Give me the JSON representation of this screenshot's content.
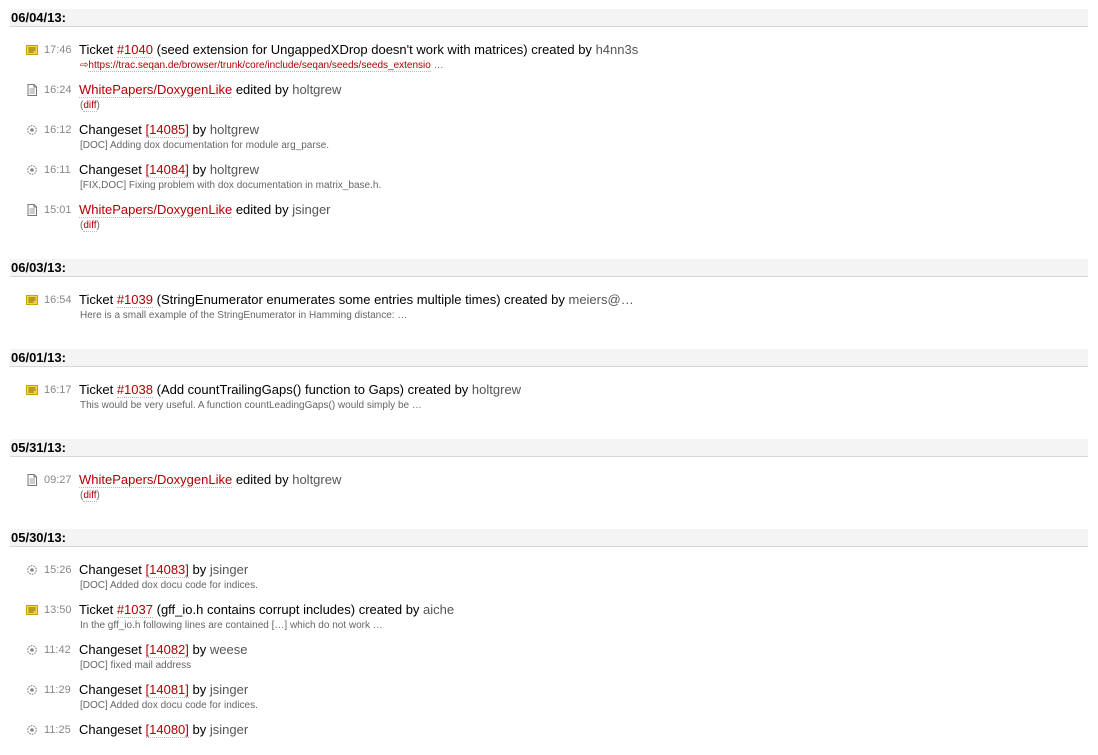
{
  "days": [
    {
      "date": "06/04/13:",
      "events": [
        {
          "kind": "ticket",
          "icon": "ticket-icon",
          "time": "17:46",
          "prefix": "Ticket",
          "link": "#1040",
          "summary": "(seed extension for UngappedXDrop doesn't work with matrices)",
          "middle": "created by",
          "author": "h4nn3s",
          "url_arrow": "⇨",
          "url": "https://trac.seqan.de/browser/trunk/core/include/seqan/seeds/seeds_extensio",
          "url_suffix": "…"
        },
        {
          "kind": "wiki",
          "icon": "wiki-page-icon",
          "time": "16:24",
          "link": "WhitePapers/DoxygenLike",
          "middle": "edited by",
          "author": "holtgrew",
          "diff": "diff"
        },
        {
          "kind": "changeset",
          "icon": "changeset-icon",
          "time": "16:12",
          "prefix": "Changeset",
          "link": "[14085]",
          "middle": "by",
          "author": "holtgrew",
          "message": "[DOC] Adding dox documentation for module arg_parse."
        },
        {
          "kind": "changeset",
          "icon": "changeset-icon",
          "time": "16:11",
          "prefix": "Changeset",
          "link": "[14084]",
          "middle": "by",
          "author": "holtgrew",
          "message": "[FIX,DOC] Fixing problem with dox documentation in matrix_base.h."
        },
        {
          "kind": "wiki",
          "icon": "wiki-page-icon",
          "time": "15:01",
          "link": "WhitePapers/DoxygenLike",
          "middle": "edited by",
          "author": "jsinger",
          "diff": "diff"
        }
      ]
    },
    {
      "date": "06/03/13:",
      "events": [
        {
          "kind": "ticket",
          "icon": "ticket-icon",
          "time": "16:54",
          "prefix": "Ticket",
          "link": "#1039",
          "summary": "(StringEnumerator enumerates some entries multiple times)",
          "middle": "created by",
          "author": "meiers@…",
          "message": "Here is a small example of the StringEnumerator in Hamming distance: …"
        }
      ]
    },
    {
      "date": "06/01/13:",
      "events": [
        {
          "kind": "ticket",
          "icon": "ticket-icon",
          "time": "16:17",
          "prefix": "Ticket",
          "link": "#1038",
          "summary": "(Add countTrailingGaps() function to Gaps)",
          "middle": "created by",
          "author": "holtgrew",
          "message": "This would be very useful. A function countLeadingGaps() would simply be …"
        }
      ]
    },
    {
      "date": "05/31/13:",
      "events": [
        {
          "kind": "wiki",
          "icon": "wiki-page-icon",
          "time": "09:27",
          "link": "WhitePapers/DoxygenLike",
          "middle": "edited by",
          "author": "holtgrew",
          "diff": "diff"
        }
      ]
    },
    {
      "date": "05/30/13:",
      "events": [
        {
          "kind": "changeset",
          "icon": "changeset-icon",
          "time": "15:26",
          "prefix": "Changeset",
          "link": "[14083]",
          "middle": "by",
          "author": "jsinger",
          "message": "[DOC] Added dox docu code for indices."
        },
        {
          "kind": "ticket",
          "icon": "ticket-icon",
          "time": "13:50",
          "prefix": "Ticket",
          "link": "#1037",
          "summary": "(gff_io.h contains corrupt includes)",
          "middle": "created by",
          "author": "aiche",
          "message": "In the gff_io.h following lines are contained […] which do not work …"
        },
        {
          "kind": "changeset",
          "icon": "changeset-icon",
          "time": "11:42",
          "prefix": "Changeset",
          "link": "[14082]",
          "middle": "by",
          "author": "weese",
          "message": "[DOC] fixed mail address"
        },
        {
          "kind": "changeset",
          "icon": "changeset-icon",
          "time": "11:29",
          "prefix": "Changeset",
          "link": "[14081]",
          "middle": "by",
          "author": "jsinger",
          "message": "[DOC] Added dox docu code for indices."
        },
        {
          "kind": "changeset",
          "icon": "changeset-icon",
          "time": "11:25",
          "prefix": "Changeset",
          "link": "[14080]",
          "middle": "by",
          "author": "jsinger"
        }
      ]
    }
  ],
  "colors": {
    "link": "#b00000",
    "author": "#555555",
    "time": "#888888",
    "message": "#666666",
    "day_header_bg": "#f4f4f4",
    "ticket_icon": "#f2d43a"
  }
}
